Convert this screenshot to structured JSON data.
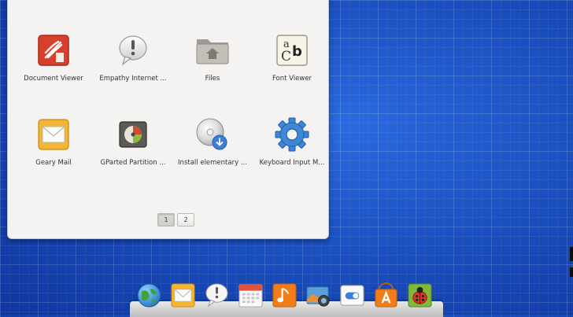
{
  "launcher": {
    "apps": [
      {
        "label": "Document Viewer",
        "icon": "document-viewer-icon"
      },
      {
        "label": "Empathy Internet ...",
        "icon": "empathy-icon"
      },
      {
        "label": "Files",
        "icon": "files-folder-icon"
      },
      {
        "label": "Font Viewer",
        "icon": "font-viewer-icon"
      },
      {
        "label": "Geary Mail",
        "icon": "geary-mail-icon"
      },
      {
        "label": "GParted Partition ...",
        "icon": "gparted-icon"
      },
      {
        "label": "Install elementary ...",
        "icon": "install-disc-icon"
      },
      {
        "label": "Keyboard Input M...",
        "icon": "keyboard-input-gear-icon"
      }
    ],
    "pager": {
      "page1": "1",
      "page2": "2",
      "active": "1"
    }
  },
  "dock": {
    "items": [
      {
        "name": "browser-globe-icon"
      },
      {
        "name": "mail-icon"
      },
      {
        "name": "chat-bubble-icon"
      },
      {
        "name": "calendar-icon"
      },
      {
        "name": "music-icon"
      },
      {
        "name": "photos-icon"
      },
      {
        "name": "settings-toggle-icon"
      },
      {
        "name": "app-center-icon"
      },
      {
        "name": "bug-icon"
      }
    ]
  },
  "colors": {
    "desktop": "#1749b8",
    "panel": "#f4f3f1"
  }
}
